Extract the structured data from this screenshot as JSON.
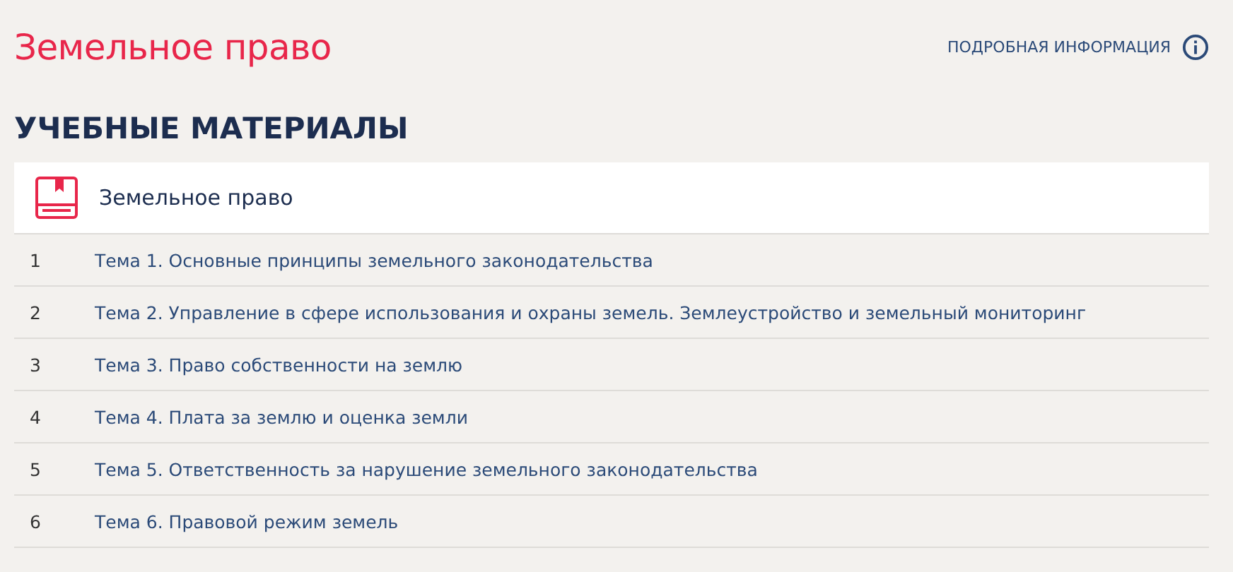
{
  "title": "Земельное право",
  "info_link": "ПОДРОБНАЯ ИНФОРМАЦИЯ",
  "section_heading": "УЧЕБНЫЕ МАТЕРИАЛЫ",
  "course": {
    "title": "Земельное право"
  },
  "topics": [
    {
      "number": "1",
      "title": "Тема 1. Основные принципы земельного законодательства"
    },
    {
      "number": "2",
      "title": "Тема 2. Управление в сфере использования и охраны земель. Землеустройство и земельный мониторинг"
    },
    {
      "number": "3",
      "title": "Тема 3. Право собственности на землю"
    },
    {
      "number": "4",
      "title": "Тема 4. Плата за землю и оценка земли"
    },
    {
      "number": "5",
      "title": "Тема 5. Ответственность за нарушение земельного законодательства"
    },
    {
      "number": "6",
      "title": "Тема 6. Правовой режим земель"
    }
  ]
}
